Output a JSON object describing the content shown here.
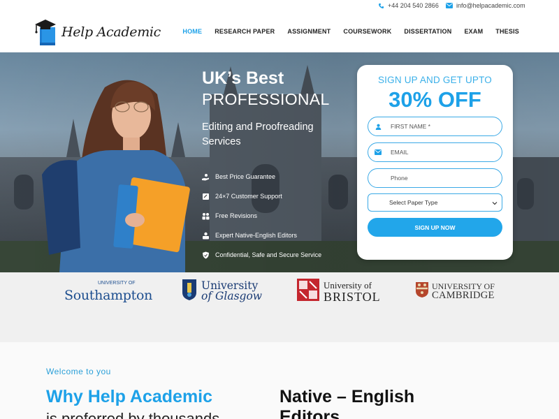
{
  "topbar": {
    "phone": "+44 204 540 2866",
    "email": "info@helpacademic.com"
  },
  "brand": {
    "name": "Help Academic",
    "accent": "#1da1e8"
  },
  "nav": {
    "items": [
      {
        "label": "HOME",
        "active": true
      },
      {
        "label": "RESEARCH PAPER",
        "active": false
      },
      {
        "label": "ASSIGNMENT",
        "active": false
      },
      {
        "label": "COURSEWORK",
        "active": false
      },
      {
        "label": "DISSERTATION",
        "active": false
      },
      {
        "label": "EXAM",
        "active": false
      },
      {
        "label": "THESIS",
        "active": false
      }
    ]
  },
  "hero": {
    "title_line1": "UK’s Best",
    "title_line2": "PROFESSIONAL",
    "subtitle": "Editing and Proofreading Services",
    "features": [
      {
        "icon": "hand-coin-icon",
        "label": "Best Price Guarantee"
      },
      {
        "icon": "support-icon",
        "label": "24×7 Customer Support"
      },
      {
        "icon": "revisions-icon",
        "label": "Free Revisions"
      },
      {
        "icon": "editor-icon",
        "label": "Expert Native-English Editors"
      },
      {
        "icon": "shield-icon",
        "label": "Confidential, Safe and Secure Service"
      }
    ]
  },
  "signup": {
    "heading": "SIGN UP AND GET UPTO",
    "offer": "30% OFF",
    "first_name_placeholder": "FIRST NAME *",
    "email_placeholder": "EMAIL",
    "phone_placeholder": "Phone",
    "paper_type_selected": "Select Paper Type",
    "submit_label": "SIGN UP NOW"
  },
  "universities": {
    "southampton_small": "UNIVERSITY OF",
    "southampton_name": "Southampton",
    "glasgow_line1": "University",
    "glasgow_line2": "of Glasgow",
    "bristol_line1": "University of",
    "bristol_line2": "BRISTOL",
    "cambridge_line1": "UNIVERSITY OF",
    "cambridge_line2": "CAMBRIDGE"
  },
  "about": {
    "welcome": "Welcome to you",
    "heading": "Why Help Academic",
    "subheading": "is preferred by thousands",
    "native_heading": "Native – English Editors"
  }
}
